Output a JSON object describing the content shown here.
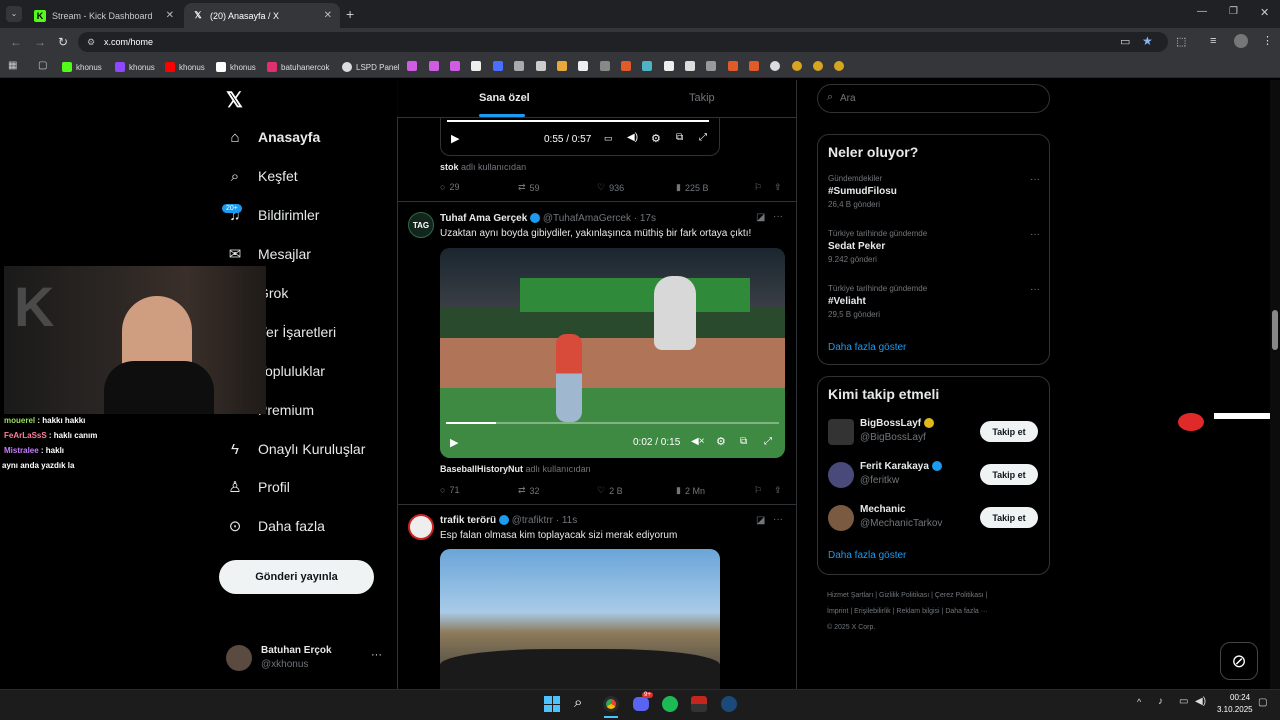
{
  "browser": {
    "tabs": [
      {
        "title": "Stream - Kick Dashboard",
        "icon": "K"
      },
      {
        "title": "(20) Anasayfa / X",
        "icon": "X"
      }
    ],
    "url": "x.com/home",
    "bookmarks": [
      "khonus",
      "khonus",
      "khonus",
      "khonus",
      "batuhanercok",
      "LSPD Panel"
    ]
  },
  "nav": {
    "items": [
      {
        "label": "Anasayfa",
        "icon": "home-icon"
      },
      {
        "label": "Keşfet",
        "icon": "search-icon"
      },
      {
        "label": "Bildirimler",
        "icon": "bell-icon",
        "badge": "20+"
      },
      {
        "label": "Mesajlar",
        "icon": "mail-icon"
      },
      {
        "label": "Grok",
        "icon": "grok-icon"
      },
      {
        "label": "Yer İşaretleri",
        "icon": "bookmark-icon"
      },
      {
        "label": "Topluluklar",
        "icon": "communities-icon"
      },
      {
        "label": "Premium",
        "icon": "x-icon"
      },
      {
        "label": "Onaylı Kuruluşlar",
        "icon": "lightning-icon"
      },
      {
        "label": "Profil",
        "icon": "person-icon"
      },
      {
        "label": "Daha fazla",
        "icon": "more-circle-icon"
      }
    ],
    "post_button": "Gönderi yayınla",
    "account": {
      "name": "Batuhan Erçok",
      "handle": "@xkhonus"
    }
  },
  "feed": {
    "tabs": [
      "Sana özel",
      "Takip"
    ],
    "post1": {
      "video_time": "0:55 / 0:57",
      "source": "stok",
      "source_suffix": "adlı kullanıcıdan",
      "replies": "29",
      "reposts": "59",
      "likes": "936",
      "views": "225 B"
    },
    "post2": {
      "name": "Tuhaf Ama Gerçek",
      "handle": "@TuhafAmaGercek · 17s",
      "avatar": "TAG",
      "text": "Uzaktan aynı boyda gibiydiler, yakınlaşınca müthiş bir fark ortaya çıktı!",
      "video_time": "0:02 / 0:15",
      "source": "BaseballHistoryNut",
      "source_suffix": "adlı kullanıcıdan",
      "replies": "71",
      "reposts": "32",
      "likes": "2 B",
      "views": "2 Mn"
    },
    "post3": {
      "name": "trafik terörü",
      "handle": "@trafiktrr · 11s",
      "text": "Esp falan olmasa kim toplayacak sizi merak ediyorum"
    }
  },
  "search": {
    "placeholder": "Ara"
  },
  "trends": {
    "title": "Neler oluyor?",
    "items": [
      {
        "context": "Gündemdekiler",
        "name": "#SumudFilosu",
        "count": "26,4 B gönderi"
      },
      {
        "context": "Türkiye tarihinde gündemde",
        "name": "Sedat Peker",
        "count": "9.242 gönderi"
      },
      {
        "context": "Türkiye tarihinde gündemde",
        "name": "#Veliaht",
        "count": "29,5 B gönderi"
      }
    ],
    "more": "Daha fazla göster"
  },
  "who_to_follow": {
    "title": "Kimi takip etmeli",
    "users": [
      {
        "name": "BigBossLayf",
        "handle": "@BigBossLayf"
      },
      {
        "name": "Ferit Karakaya",
        "handle": "@feritkw"
      },
      {
        "name": "Mechanic",
        "handle": "@MechanicTarkov"
      }
    ],
    "follow_label": "Takip et",
    "more": "Daha fazla göster"
  },
  "footer": {
    "links": [
      "Hizmet Şartları",
      "Gizlilik Politikası",
      "Çerez Politikası",
      "İmprint",
      "Erişilebilirlik",
      "Reklam bilgisi",
      "Daha fazla ···"
    ],
    "copyright": "© 2025 X Corp."
  },
  "stream_chat": [
    {
      "user": "mouerel",
      "msg": "hakkı hakkı",
      "color": "#9be05a"
    },
    {
      "user": "FeArLaSsS",
      "msg": "haklı canım",
      "color": "#ff7f9f"
    },
    {
      "user": "Mistralee",
      "msg": "haklı",
      "color": "#c77dff"
    },
    {
      "user": "",
      "msg": "aynı anda yazdık la",
      "color": "#ffffff"
    }
  ],
  "taskbar": {
    "time": "00:24",
    "date": "3.10.2025",
    "discord_badge": "9+"
  }
}
